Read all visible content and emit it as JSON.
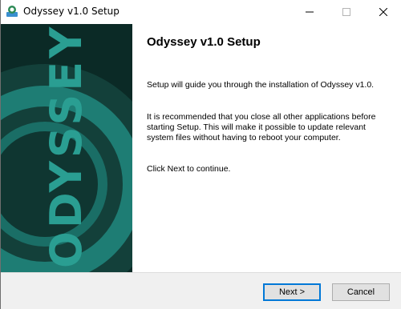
{
  "window": {
    "title": "Odyssey v1.0 Setup"
  },
  "banner": {
    "wordmark": "ODYSSEY",
    "colors": {
      "background": "#0b2a26",
      "accent": "#1e7d74",
      "text": "#2a9e92"
    }
  },
  "page": {
    "heading": "Odyssey v1.0 Setup",
    "paragraphs": [
      "Setup will guide you through the installation of Odyssey v1.0.",
      "It is recommended that you close all other applications before starting Setup. This will make it possible to update relevant system files without having to reboot your computer.",
      "Click Next to continue."
    ]
  },
  "buttons": {
    "next_label": "Next >",
    "cancel_label": "Cancel"
  },
  "icons": {
    "app": "installer-icon",
    "minimize": "minimize-icon",
    "maximize": "maximize-icon",
    "close": "close-icon"
  }
}
